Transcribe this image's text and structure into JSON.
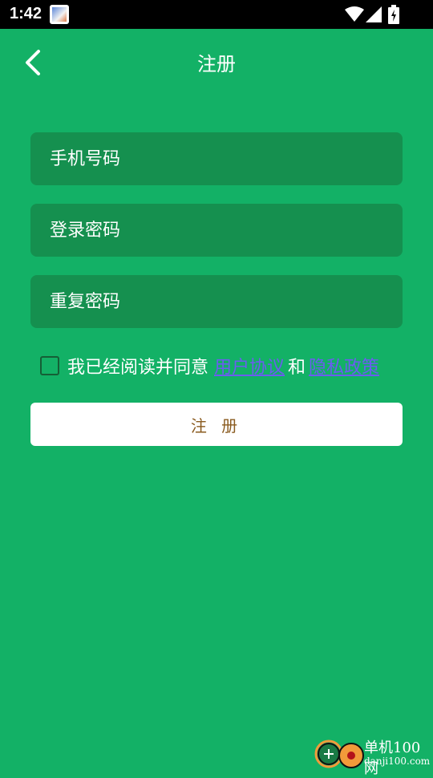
{
  "status_bar": {
    "time": "1:42"
  },
  "header": {
    "title": "注册"
  },
  "form": {
    "phone_placeholder": "手机号码",
    "password_placeholder": "登录密码",
    "repeat_password_placeholder": "重复密码"
  },
  "agreement": {
    "prefix": "我已经阅读并同意",
    "user_agreement": "用户协议",
    "and": "和",
    "privacy_policy": "隐私政策",
    "checked": false
  },
  "register_button": {
    "label": "注 册"
  },
  "watermark": {
    "site_name": "单机100网",
    "site_url": "danji100.com"
  },
  "colors": {
    "background": "#13b166",
    "field": "#15904f",
    "link": "#6b5cf0",
    "button_text": "#8a5b1f"
  }
}
